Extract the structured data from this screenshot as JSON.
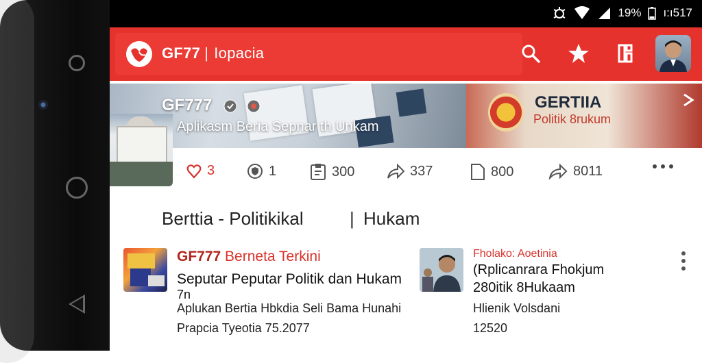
{
  "status": {
    "battery": "19%",
    "time": "ı:ı517"
  },
  "app": {
    "brand": "GF77",
    "separator": "|",
    "subtitle": "Iopacia",
    "accent": "#e5322d"
  },
  "toolbar": {
    "icons": [
      "search-icon",
      "star-icon",
      "bookmark-icon"
    ]
  },
  "hero": {
    "title": "GF777",
    "subtitle": "Aplikasm Beria Sepnar th Unkam",
    "right_title": "GERTIIA",
    "right_sub": "Pоlitik 8rukum"
  },
  "actions": [
    {
      "icon": "heart-icon",
      "count": "3"
    },
    {
      "icon": "shield-icon",
      "count": "1"
    },
    {
      "icon": "clipboard-icon",
      "count": "300"
    },
    {
      "icon": "share-icon",
      "count": "337"
    },
    {
      "icon": "document-icon",
      "count": "800"
    },
    {
      "icon": "forward-icon",
      "count": "8011"
    }
  ],
  "section": {
    "title": "Berttia - Politikikal",
    "separator": "|",
    "title2": "Hukam"
  },
  "cards": [
    {
      "label": "GF777",
      "label_rest": "Berneta Terkini",
      "title_line1": "Seputar Peputar Politik dan Hukam",
      "title_line2": "7n",
      "desc": "Aplukan Bertia Hbkdia Seli Bama Hunahi",
      "meta": "Prapcia Tyeotia 75.2077"
    },
    {
      "label": "Fholako: Aoetinia",
      "title_line1": "(Rplicanrara Fhokjum",
      "title_line2": "280itik 8Hukaam",
      "desc": "Hlienik Volsdani",
      "meta": "12520"
    }
  ]
}
